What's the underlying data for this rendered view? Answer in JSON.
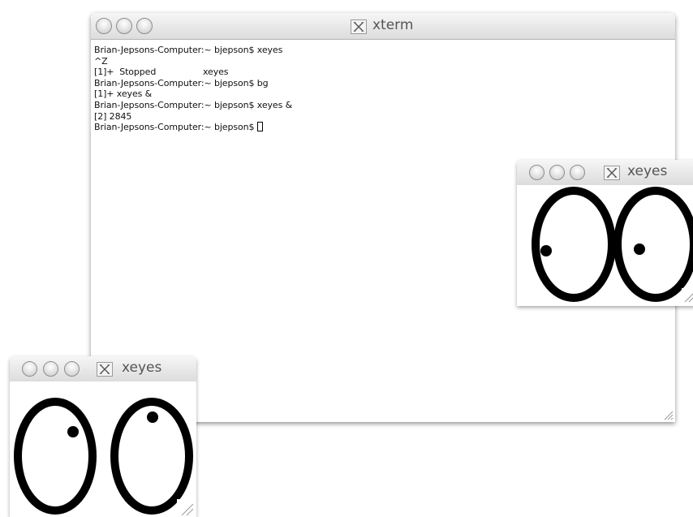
{
  "xterm": {
    "title": "xterm",
    "lines": [
      "Brian-Jepsons-Computer:~ bjepson$ xeyes",
      "^Z",
      "[1]+  Stopped                 xeyes",
      "Brian-Jepsons-Computer:~ bjepson$ bg",
      "[1]+ xeyes &",
      "Brian-Jepsons-Computer:~ bjepson$ xeyes &",
      "[2] 2845"
    ],
    "prompt": "Brian-Jepsons-Computer:~ bjepson$ "
  },
  "xeyes_right": {
    "title": "xeyes"
  },
  "xeyes_left": {
    "title": "xeyes"
  },
  "icons": {
    "window_buttons": [
      "close-button",
      "minimize-button",
      "zoom-button"
    ],
    "app_icon": "x11-icon",
    "resize": "resize-grip-icon"
  },
  "colors": {
    "titlebar_top": "#f6f6f6",
    "titlebar_bottom": "#dcdcdc",
    "terminal_text": "#111111",
    "eye_stroke": "#000000",
    "eye_fill": "#ffffff"
  }
}
